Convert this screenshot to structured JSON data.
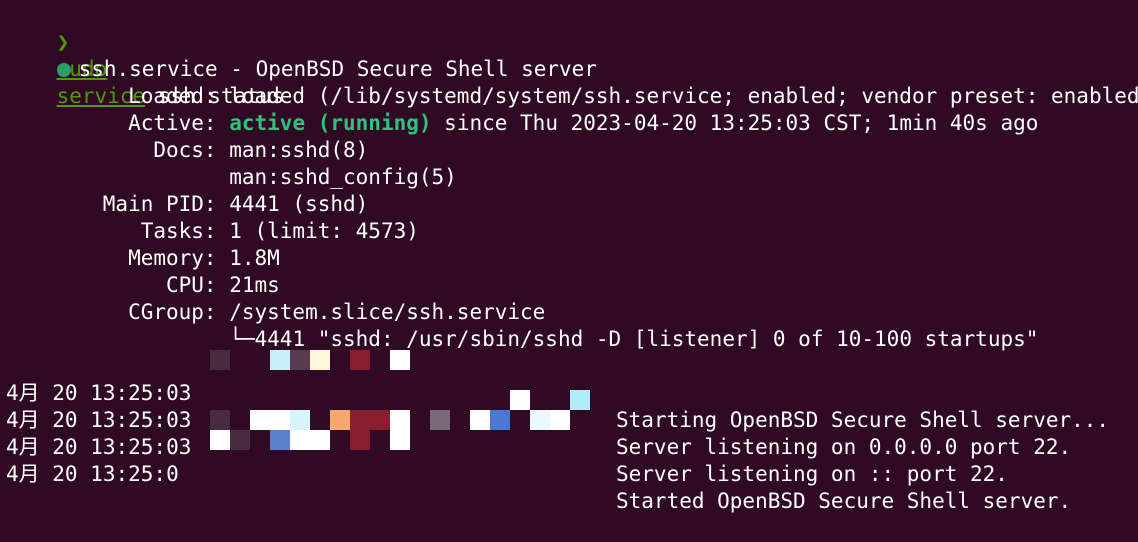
{
  "prompt": {
    "arrow": "❯",
    "cmd_sudo": "sudo",
    "cmd_service": "service",
    "cmd_rest": " ssh status"
  },
  "status": {
    "unit_line": "ssh.service - OpenBSD Secure Shell server",
    "loaded_label": "Loaded:",
    "loaded_value": " loaded (/lib/systemd/system/ssh.service; enabled; vendor preset: enabled)",
    "active_label": "Active:",
    "active_state": "active (running)",
    "active_since": " since Thu 2023-04-20 13:25:03 CST; 1min 40s ago",
    "docs_label": "Docs:",
    "docs_1": " man:sshd(8)",
    "docs_2": "man:sshd_config(5)",
    "pid_label": "Main PID:",
    "pid_value": " 4441 (sshd)",
    "tasks_label": "Tasks:",
    "tasks_value": " 1 (limit: 4573)",
    "memory_label": "Memory:",
    "memory_value": " 1.8M",
    "cpu_label": "CPU:",
    "cpu_value": " 21ms",
    "cgroup_label": "CGroup:",
    "cgroup_value": " /system.slice/ssh.service",
    "cgroup_child": "└─4441 \"sshd: /usr/sbin/sshd -D [listener] 0 of 10-100 startups\""
  },
  "logs": [
    {
      "time": "4月 20 13:25:03",
      "message": "Starting OpenBSD Secure Shell server..."
    },
    {
      "time": "4月 20 13:25:03",
      "message": "Server listening on 0.0.0.0 port 22."
    },
    {
      "time": "4月 20 13:25:03",
      "message": "Server listening on :: port 22."
    },
    {
      "time": "4月 20 13:25:0",
      "message": "Started OpenBSD Secure Shell server."
    }
  ],
  "colors": {
    "background": "#300a24",
    "prompt_green": "#4e9a06",
    "active_green": "#2ec27e",
    "status_dot": "#26a269"
  }
}
